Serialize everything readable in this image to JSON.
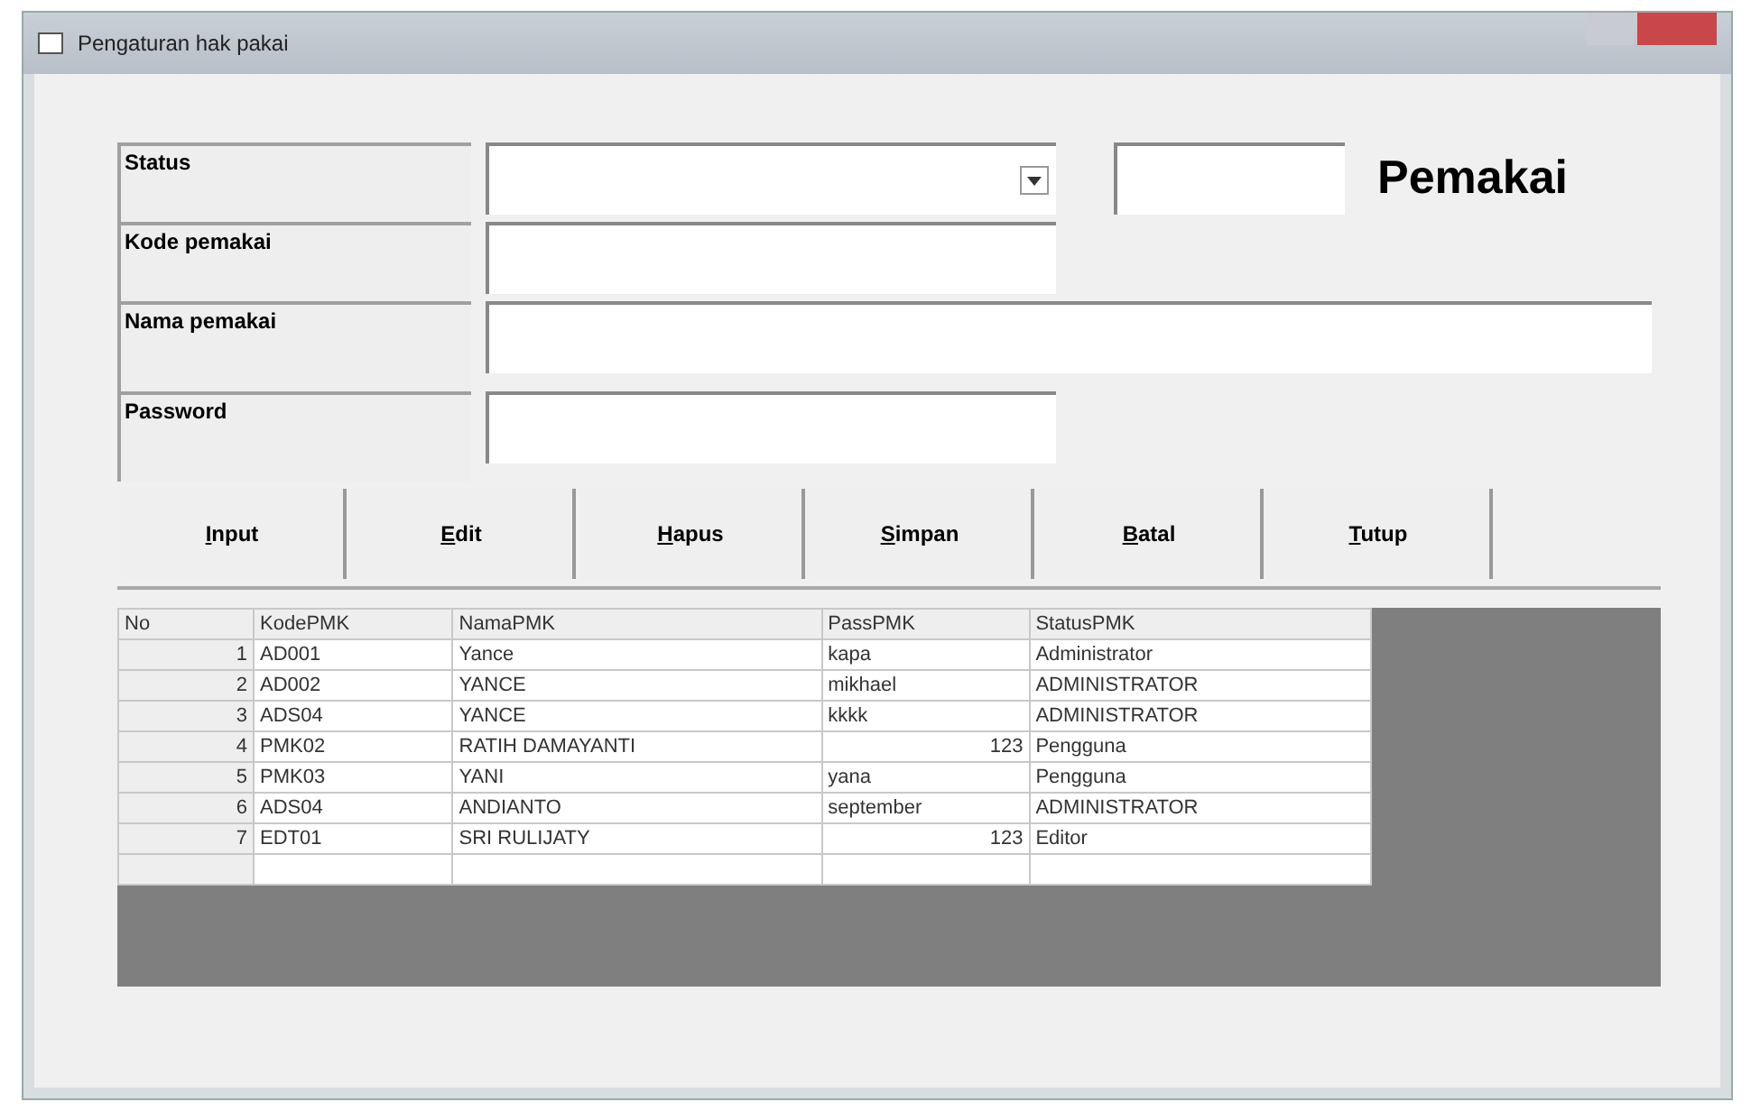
{
  "window": {
    "title": "Pengaturan hak pakai"
  },
  "form": {
    "fields": [
      {
        "label": "Status",
        "kind": "dropdown"
      },
      {
        "label": "Kode pemakai",
        "kind": "text"
      },
      {
        "label": "Nama pemakai",
        "kind": "wide"
      },
      {
        "label": "Password",
        "kind": "text"
      }
    ],
    "heading": "Pemakai"
  },
  "buttons": [
    "Input",
    "Edit",
    "Hapus",
    "Simpan",
    "Batal",
    "Tutup"
  ],
  "table": {
    "columns": [
      "No",
      "KodePMK",
      "NamaPMK",
      "PassPMK",
      "StatusPMK"
    ],
    "rows": [
      [
        "1",
        "AD001",
        "Yance",
        "kapa",
        "Administrator"
      ],
      [
        "2",
        "AD002",
        "YANCE",
        "mikhael",
        "ADMINISTRATOR"
      ],
      [
        "3",
        "ADS04",
        "YANCE",
        "kkkk",
        "ADMINISTRATOR"
      ],
      [
        "4",
        "PMK02",
        "RATIH DAMAYANTI",
        "123",
        "Pengguna"
      ],
      [
        "5",
        "PMK03",
        "YANI",
        "yana",
        "Pengguna"
      ],
      [
        "6",
        "ADS04",
        "ANDIANTO",
        "september",
        "ADMINISTRATOR"
      ],
      [
        "7",
        "EDT01",
        "SRI RULIJATY",
        "123",
        "Editor"
      ]
    ]
  }
}
